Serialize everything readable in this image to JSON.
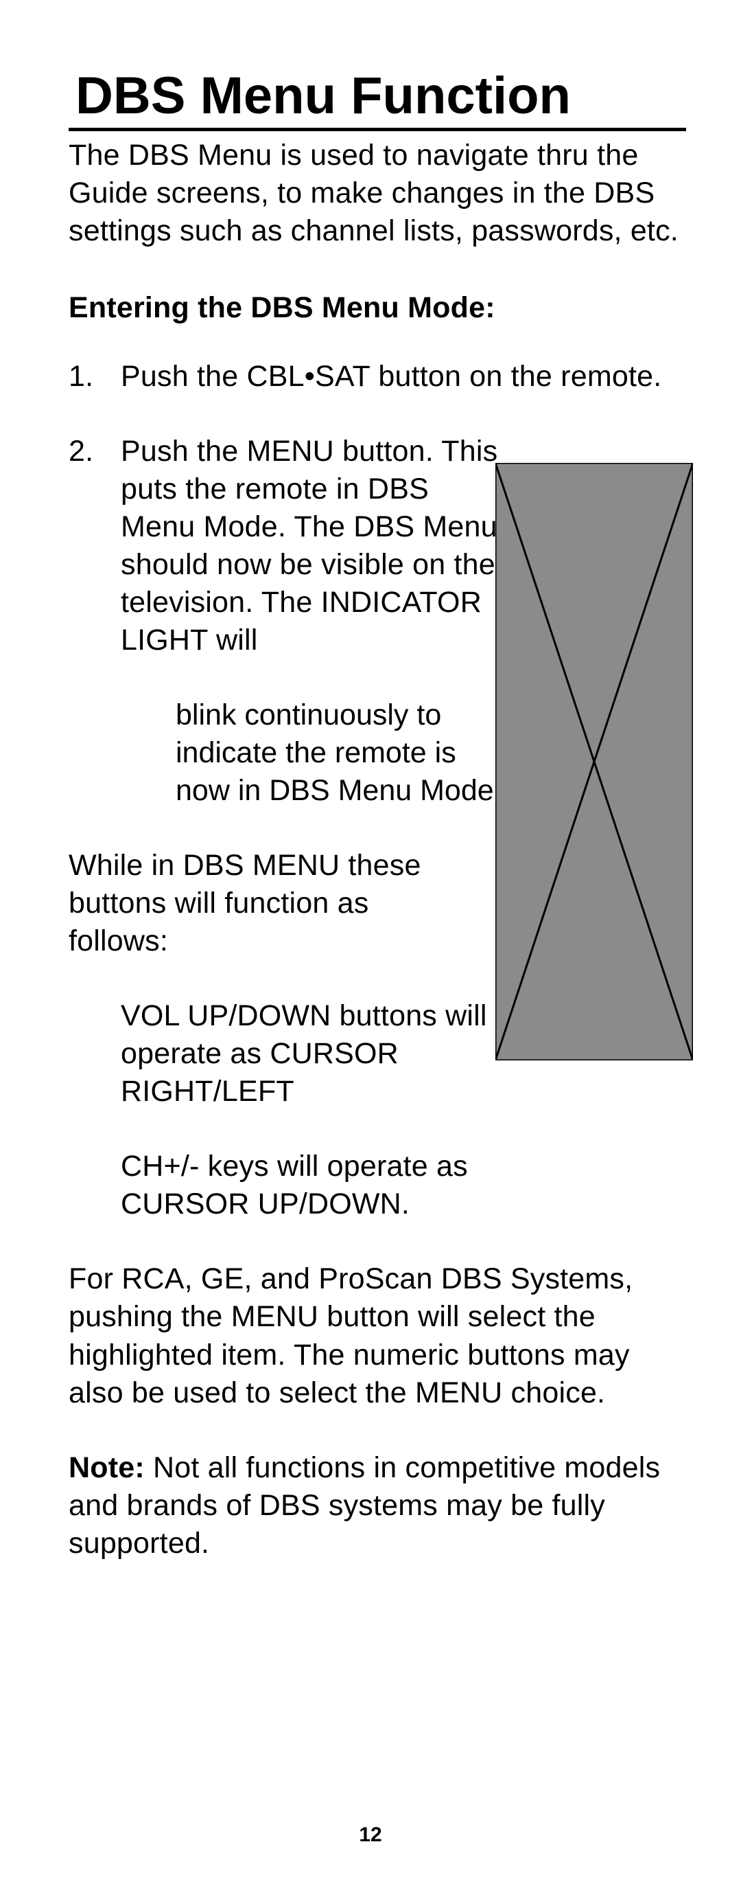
{
  "title": "DBS Menu Function",
  "intro": "The DBS Menu is used to navigate thru the Guide screens, to make changes in the DBS settings such as channel lists, passwords, etc.",
  "subhead": "Entering the DBS Menu Mode:",
  "steps": {
    "s1": {
      "num": "1.",
      "text": "Push the CBL•SAT button on the remote."
    },
    "s2": {
      "num": "2.",
      "textA": "Push the MENU button. This puts the remote in DBS Menu Mode. The DBS Menu should now be visible on the television. The INDICATOR LIGHT will",
      "textB": "blink continuously to indicate the remote is now in DBS Menu Mode."
    }
  },
  "paraA": "While in DBS MENU these buttons will function as follows:",
  "paraB": "VOL UP/DOWN buttons will operate as CURSOR RIGHT/LEFT",
  "paraC": "CH+/- keys will operate as CURSOR UP/DOWN.",
  "paraD": "For RCA, GE, and ProScan DBS Systems, pushing the MENU button will select the highlighted item. The numeric buttons may also be used to select the MENU choice.",
  "note": {
    "label": "Note:",
    "text": " Not all functions in competitive models and brands of DBS systems may be fully supported."
  },
  "pageNum": "12"
}
